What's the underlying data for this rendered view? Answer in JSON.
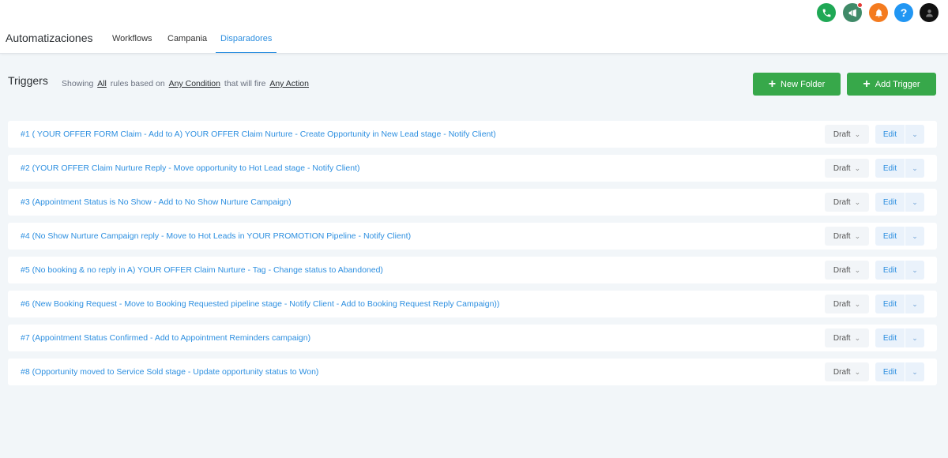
{
  "header": {
    "app_title": "Automatizaciones",
    "tabs": [
      {
        "label": "Workflows",
        "active": false
      },
      {
        "label": "Campania",
        "active": false
      },
      {
        "label": "Disparadores",
        "active": true
      }
    ],
    "icons": [
      {
        "name": "phone-icon",
        "color": "#1fa855"
      },
      {
        "name": "megaphone-icon",
        "color": "#3f8a68",
        "badge": true
      },
      {
        "name": "bell-icon",
        "color": "#f47b1f"
      },
      {
        "name": "help-icon",
        "color": "#2196f3"
      },
      {
        "name": "avatar",
        "color": "#111111"
      }
    ]
  },
  "toolbar": {
    "title": "Triggers",
    "showing": "Showing",
    "all": "All",
    "rules_based_on": "rules based on",
    "condition": "Any Condition",
    "that_will_fire": "that will fire",
    "action": "Any Action",
    "new_folder": "New Folder",
    "add_trigger": "Add Trigger"
  },
  "colors": {
    "accent": "#2d8fe0",
    "primary_button": "#37a84a"
  },
  "triggers": [
    {
      "title": "#1 ( YOUR OFFER FORM Claim - Add to A) YOUR OFFER Claim Nurture - Create Opportunity in New Lead stage - Notify Client)",
      "status": "Draft",
      "edit": "Edit"
    },
    {
      "title": "#2 (YOUR OFFER Claim Nurture Reply - Move opportunity to Hot Lead stage - Notify Client)",
      "status": "Draft",
      "edit": "Edit"
    },
    {
      "title": "#3 (Appointment Status is No Show - Add to No Show Nurture Campaign)",
      "status": "Draft",
      "edit": "Edit"
    },
    {
      "title": "#4 (No Show Nurture Campaign reply - Move to Hot Leads in YOUR PROMOTION Pipeline - Notify Client)",
      "status": "Draft",
      "edit": "Edit"
    },
    {
      "title": "#5 (No booking & no reply in A) YOUR OFFER Claim Nurture - Tag - Change status to Abandoned)",
      "status": "Draft",
      "edit": "Edit"
    },
    {
      "title": "#6 (New Booking Request - Move to Booking Requested pipeline stage - Notify Client - Add to Booking Request Reply Campaign))",
      "status": "Draft",
      "edit": "Edit"
    },
    {
      "title": "#7 (Appointment Status Confirmed - Add to Appointment Reminders campaign)",
      "status": "Draft",
      "edit": "Edit"
    },
    {
      "title": "#8 (Opportunity moved to Service Sold stage - Update opportunity status to Won)",
      "status": "Draft",
      "edit": "Edit"
    }
  ]
}
